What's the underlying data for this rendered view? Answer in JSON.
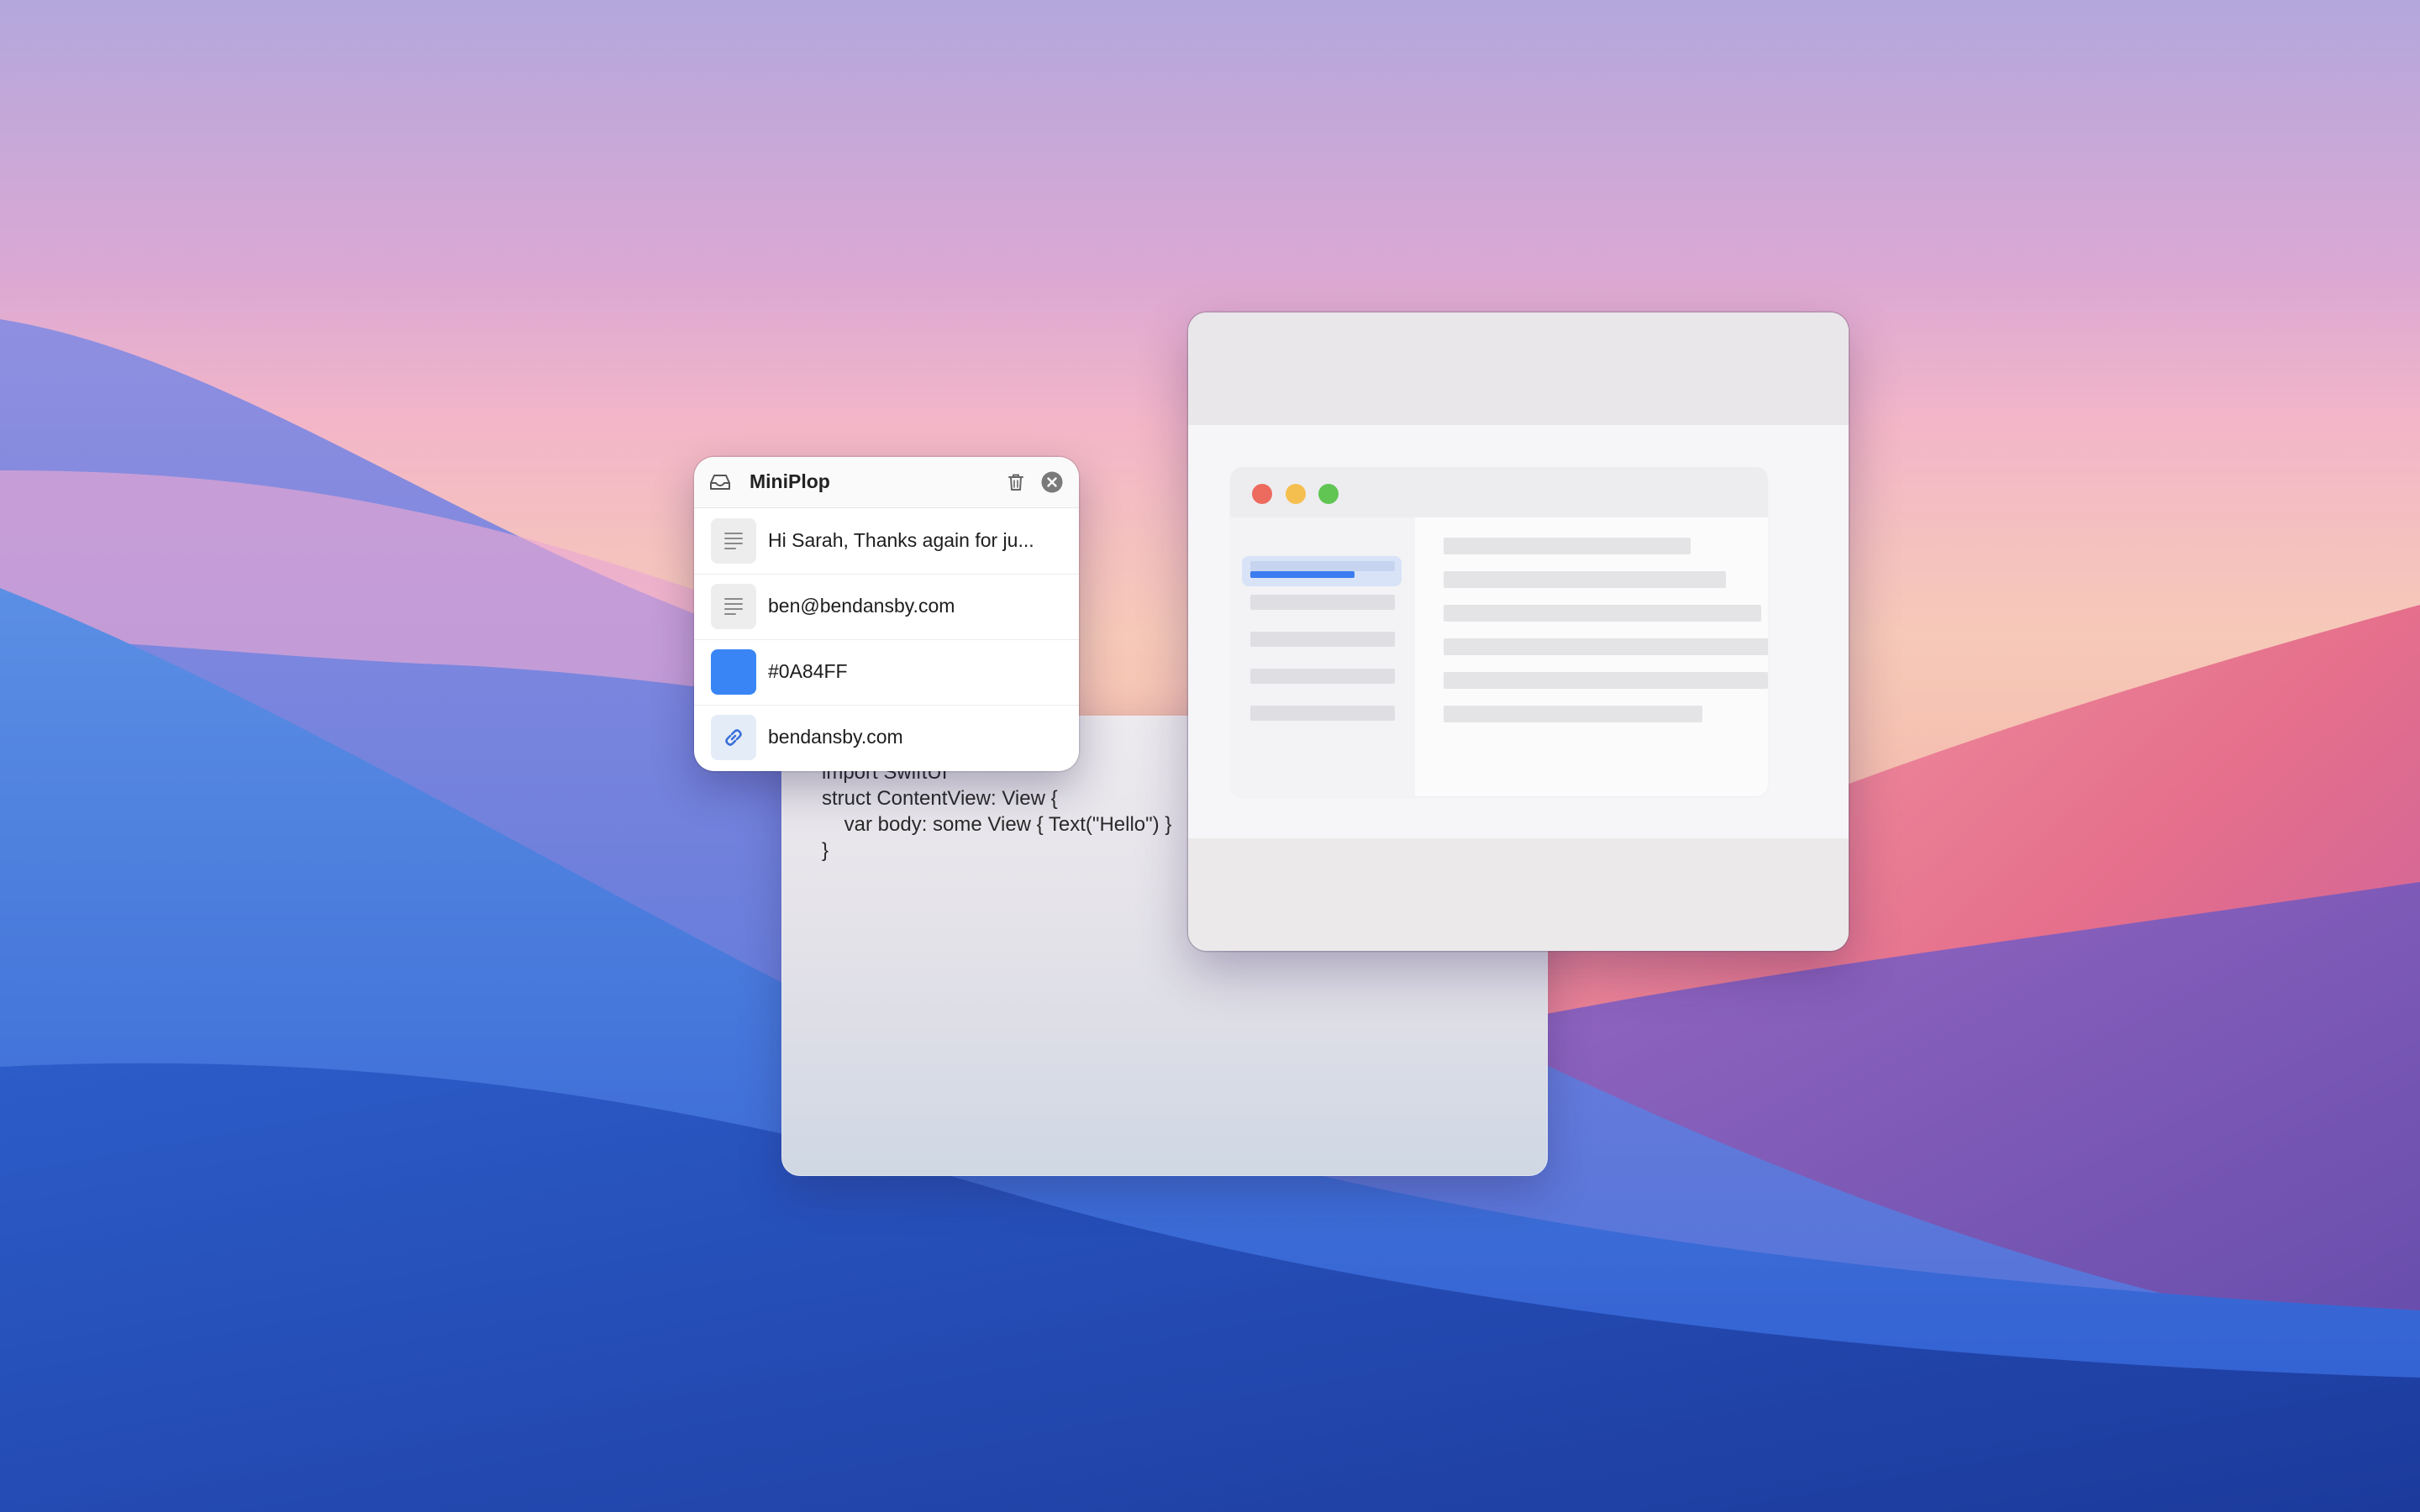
{
  "miniplop": {
    "title": "MiniPlop",
    "items": [
      {
        "kind": "text",
        "label": "Hi Sarah,  Thanks again for ju...",
        "icon": "text-lines-icon"
      },
      {
        "kind": "text",
        "label": "ben@bendansby.com",
        "icon": "text-lines-icon"
      },
      {
        "kind": "color",
        "label": "#0A84FF",
        "swatch": "#3a85f5"
      },
      {
        "kind": "link",
        "label": "bendansby.com",
        "icon": "link-icon"
      }
    ]
  },
  "code_window": {
    "lines": [
      "import SwiftUI",
      "",
      "struct ContentView: View {",
      "    var body: some View { Text(\"Hello\") }",
      "}"
    ]
  },
  "colors": {
    "accent": "#3b7cf0",
    "traffic_close": "#ed6a5e",
    "traffic_minimize": "#f5bf4f",
    "traffic_zoom": "#61c554"
  }
}
